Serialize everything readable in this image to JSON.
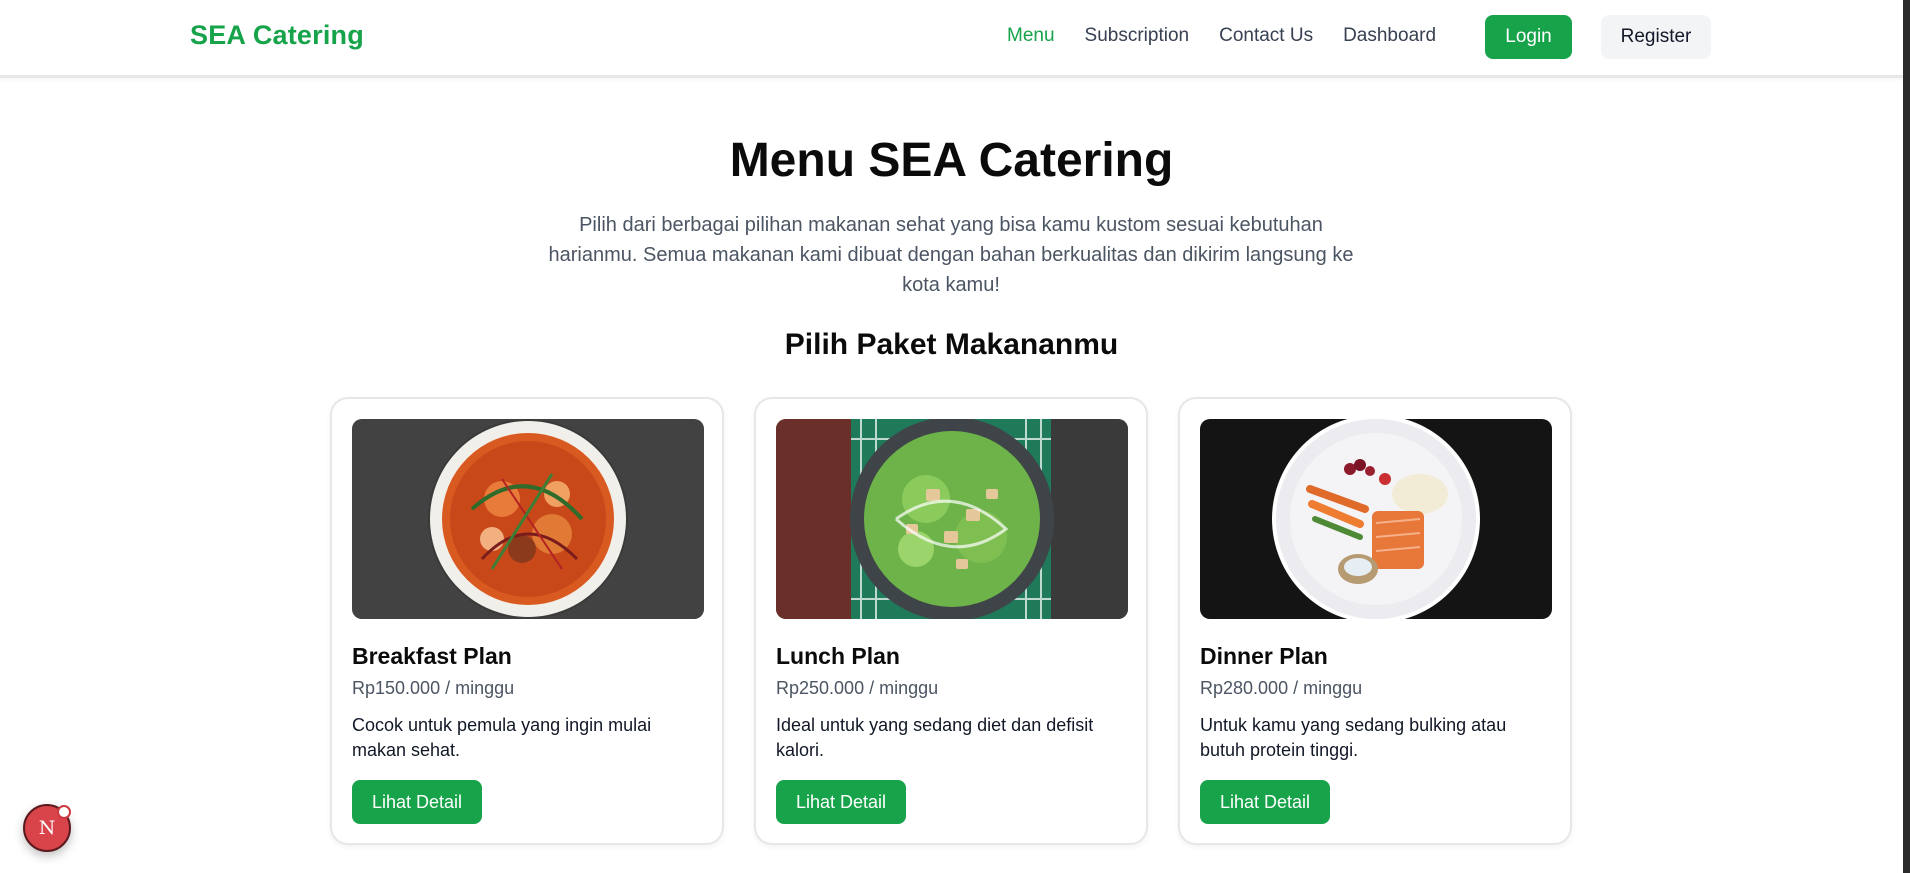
{
  "navbar": {
    "brand": "SEA Catering",
    "links": [
      {
        "label": "Menu",
        "active": true
      },
      {
        "label": "Subscription",
        "active": false
      },
      {
        "label": "Contact Us",
        "active": false
      },
      {
        "label": "Dashboard",
        "active": false
      }
    ],
    "login_label": "Login",
    "register_label": "Register"
  },
  "hero": {
    "title": "Menu SEA Catering",
    "intro": "Pilih dari berbagai pilihan makanan sehat yang bisa kamu kustom sesuai kebutuhan harianmu. Semua makanan kami dibuat dengan bahan berkualitas dan dikirim langsung ke kota kamu!"
  },
  "section": {
    "title": "Pilih Paket Makananmu"
  },
  "plans": [
    {
      "name": "Breakfast Plan",
      "price": "Rp150.000 / minggu",
      "description": "Cocok untuk pemula yang ingin mulai makan sehat.",
      "button_label": "Lihat Detail",
      "image": "seafood-curry-bowl"
    },
    {
      "name": "Lunch Plan",
      "price": "Rp250.000 / minggu",
      "description": "Ideal untuk yang sedang diet dan defisit kalori.",
      "button_label": "Lihat Detail",
      "image": "chicken-caesar-salad"
    },
    {
      "name": "Dinner Plan",
      "price": "Rp280.000 / minggu",
      "description": "Untuk kamu yang sedang bulking atau butuh protein tinggi.",
      "button_label": "Lihat Detail",
      "image": "salmon-vegetables-plate"
    }
  ],
  "dev_indicator": {
    "label": "N"
  },
  "colors": {
    "brand_green": "#16a34a",
    "text_dark": "#111827",
    "text_muted": "#4b5563"
  }
}
